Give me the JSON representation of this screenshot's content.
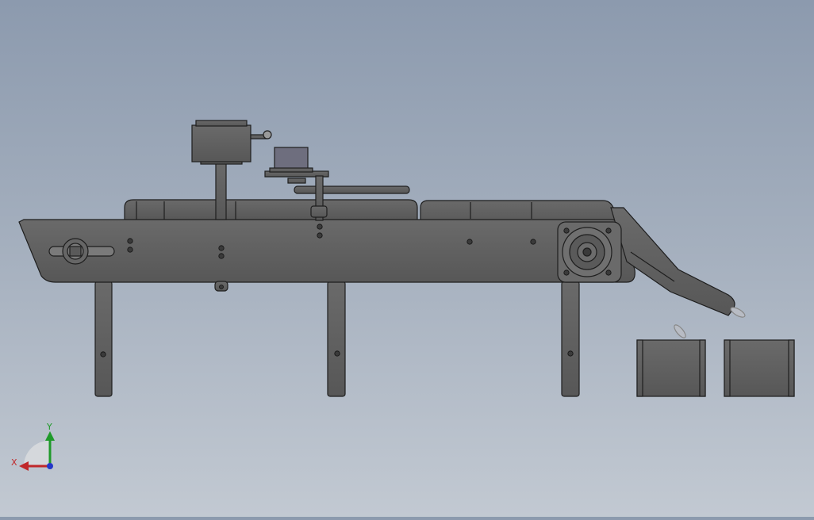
{
  "viewport": {
    "view": "Front",
    "background_top": "#8c9aae",
    "background_bottom": "#c2c9d2"
  },
  "model": {
    "body_color": "#5f5f5f",
    "edge_color": "#1e1e1e",
    "highlight_color": "#7a7a7a",
    "motor_face_color": "#6a6a6a"
  },
  "triad": {
    "x_label": "X",
    "y_label": "Y",
    "x_color": "#c0282a",
    "y_color": "#1f9a2a",
    "z_color": "#2438c8"
  }
}
